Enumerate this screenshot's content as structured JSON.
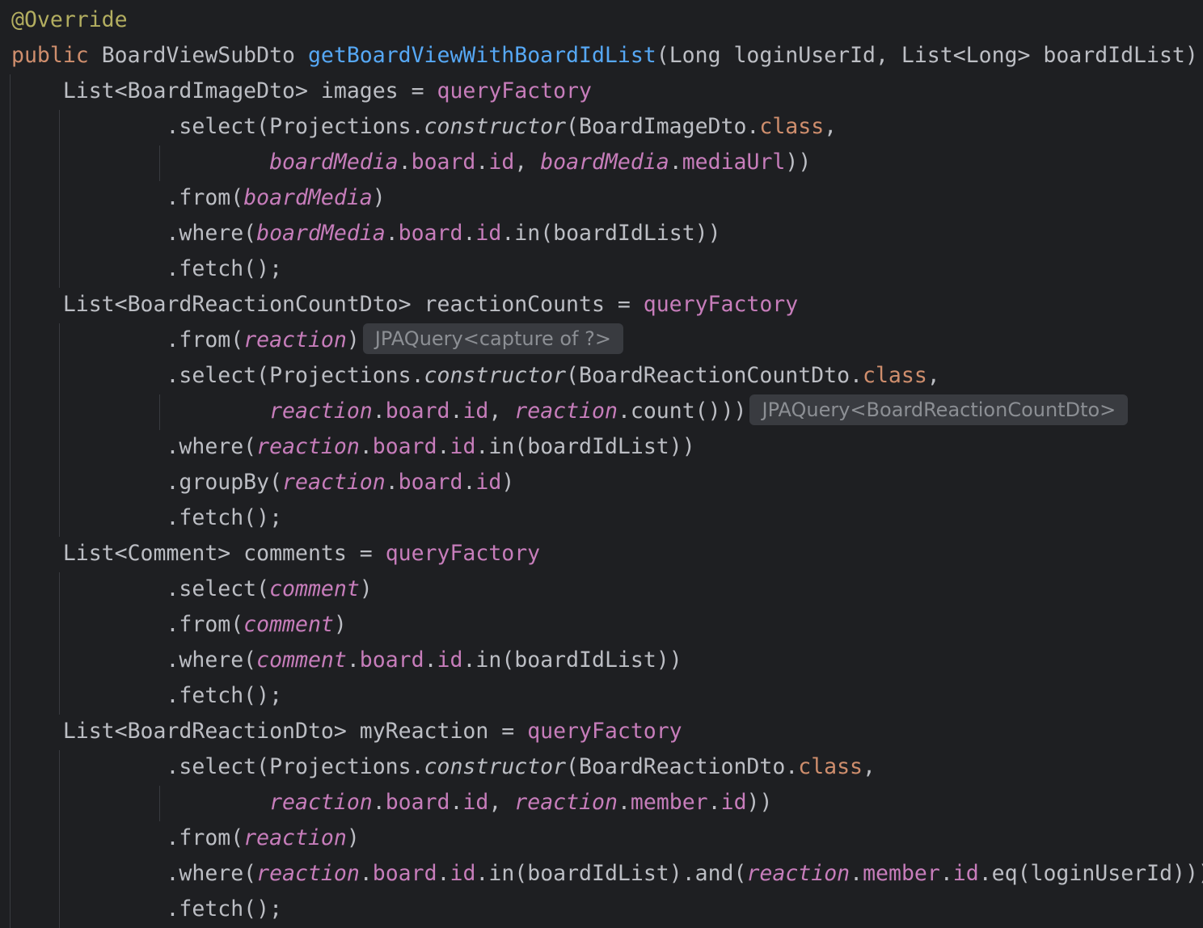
{
  "editor": {
    "theme": "dark",
    "background": "#1e1f22",
    "colors": {
      "plain": "#bcbec4",
      "annotation": "#b3ae60",
      "keyword": "#cf8e6d",
      "method_declaration": "#56a8f5",
      "field": "#c77dbb",
      "inlay_hint": "#8c8f94"
    },
    "lines": [
      [
        {
          "t": "ann",
          "s": "@Override"
        }
      ],
      [
        {
          "t": "kw",
          "s": "public"
        },
        {
          "t": "plain",
          "s": " BoardViewSubDto "
        },
        {
          "t": "fn",
          "s": "getBoardViewWithBoardIdList"
        },
        {
          "t": "plain",
          "s": "(Long loginUserId, List<Long> boardIdList) {"
        }
      ],
      [
        {
          "t": "plain",
          "s": "    List<BoardImageDto> images = "
        },
        {
          "t": "field",
          "s": "queryFactory"
        }
      ],
      [
        {
          "t": "plain",
          "s": "            .select(Projections."
        },
        {
          "t": "italic",
          "s": "constructor"
        },
        {
          "t": "plain",
          "s": "(BoardImageDto."
        },
        {
          "t": "kw",
          "s": "class"
        },
        {
          "t": "plain",
          "s": ","
        }
      ],
      [
        {
          "t": "plain",
          "s": "                    "
        },
        {
          "t": "static",
          "s": "boardMedia"
        },
        {
          "t": "plain",
          "s": "."
        },
        {
          "t": "field",
          "s": "board"
        },
        {
          "t": "plain",
          "s": "."
        },
        {
          "t": "field",
          "s": "id"
        },
        {
          "t": "plain",
          "s": ", "
        },
        {
          "t": "static",
          "s": "boardMedia"
        },
        {
          "t": "plain",
          "s": "."
        },
        {
          "t": "field",
          "s": "mediaUrl"
        },
        {
          "t": "plain",
          "s": "))"
        }
      ],
      [
        {
          "t": "plain",
          "s": "            .from("
        },
        {
          "t": "static",
          "s": "boardMedia"
        },
        {
          "t": "plain",
          "s": ")"
        }
      ],
      [
        {
          "t": "plain",
          "s": "            .where("
        },
        {
          "t": "static",
          "s": "boardMedia"
        },
        {
          "t": "plain",
          "s": "."
        },
        {
          "t": "field",
          "s": "board"
        },
        {
          "t": "plain",
          "s": "."
        },
        {
          "t": "field",
          "s": "id"
        },
        {
          "t": "plain",
          "s": ".in(boardIdList))"
        }
      ],
      [
        {
          "t": "plain",
          "s": "            .fetch();"
        }
      ],
      [
        {
          "t": "plain",
          "s": "    List<BoardReactionCountDto> reactionCounts = "
        },
        {
          "t": "field",
          "s": "queryFactory"
        }
      ],
      [
        {
          "t": "plain",
          "s": "            .from("
        },
        {
          "t": "static",
          "s": "reaction"
        },
        {
          "t": "plain",
          "s": ")"
        },
        {
          "t": "hint",
          "s": "JPAQuery<capture of ?>"
        }
      ],
      [
        {
          "t": "plain",
          "s": "            .select(Projections."
        },
        {
          "t": "italic",
          "s": "constructor"
        },
        {
          "t": "plain",
          "s": "(BoardReactionCountDto."
        },
        {
          "t": "kw",
          "s": "class"
        },
        {
          "t": "plain",
          "s": ","
        }
      ],
      [
        {
          "t": "plain",
          "s": "                    "
        },
        {
          "t": "static",
          "s": "reaction"
        },
        {
          "t": "plain",
          "s": "."
        },
        {
          "t": "field",
          "s": "board"
        },
        {
          "t": "plain",
          "s": "."
        },
        {
          "t": "field",
          "s": "id"
        },
        {
          "t": "plain",
          "s": ", "
        },
        {
          "t": "static",
          "s": "reaction"
        },
        {
          "t": "plain",
          "s": ".count()))"
        },
        {
          "t": "hint",
          "s": "JPAQuery<BoardReactionCountDto>"
        }
      ],
      [
        {
          "t": "plain",
          "s": "            .where("
        },
        {
          "t": "static",
          "s": "reaction"
        },
        {
          "t": "plain",
          "s": "."
        },
        {
          "t": "field",
          "s": "board"
        },
        {
          "t": "plain",
          "s": "."
        },
        {
          "t": "field",
          "s": "id"
        },
        {
          "t": "plain",
          "s": ".in(boardIdList))"
        }
      ],
      [
        {
          "t": "plain",
          "s": "            .groupBy("
        },
        {
          "t": "static",
          "s": "reaction"
        },
        {
          "t": "plain",
          "s": "."
        },
        {
          "t": "field",
          "s": "board"
        },
        {
          "t": "plain",
          "s": "."
        },
        {
          "t": "field",
          "s": "id"
        },
        {
          "t": "plain",
          "s": ")"
        }
      ],
      [
        {
          "t": "plain",
          "s": "            .fetch();"
        }
      ],
      [
        {
          "t": "plain",
          "s": "    List<Comment> comments = "
        },
        {
          "t": "field",
          "s": "queryFactory"
        }
      ],
      [
        {
          "t": "plain",
          "s": "            .select("
        },
        {
          "t": "static",
          "s": "comment"
        },
        {
          "t": "plain",
          "s": ")"
        }
      ],
      [
        {
          "t": "plain",
          "s": "            .from("
        },
        {
          "t": "static",
          "s": "comment"
        },
        {
          "t": "plain",
          "s": ")"
        }
      ],
      [
        {
          "t": "plain",
          "s": "            .where("
        },
        {
          "t": "static",
          "s": "comment"
        },
        {
          "t": "plain",
          "s": "."
        },
        {
          "t": "field",
          "s": "board"
        },
        {
          "t": "plain",
          "s": "."
        },
        {
          "t": "field",
          "s": "id"
        },
        {
          "t": "plain",
          "s": ".in(boardIdList))"
        }
      ],
      [
        {
          "t": "plain",
          "s": "            .fetch();"
        }
      ],
      [
        {
          "t": "plain",
          "s": "    List<BoardReactionDto> myReaction = "
        },
        {
          "t": "field",
          "s": "queryFactory"
        }
      ],
      [
        {
          "t": "plain",
          "s": "            .select(Projections."
        },
        {
          "t": "italic",
          "s": "constructor"
        },
        {
          "t": "plain",
          "s": "(BoardReactionDto."
        },
        {
          "t": "kw",
          "s": "class"
        },
        {
          "t": "plain",
          "s": ","
        }
      ],
      [
        {
          "t": "plain",
          "s": "                    "
        },
        {
          "t": "static",
          "s": "reaction"
        },
        {
          "t": "plain",
          "s": "."
        },
        {
          "t": "field",
          "s": "board"
        },
        {
          "t": "plain",
          "s": "."
        },
        {
          "t": "field",
          "s": "id"
        },
        {
          "t": "plain",
          "s": ", "
        },
        {
          "t": "static",
          "s": "reaction"
        },
        {
          "t": "plain",
          "s": "."
        },
        {
          "t": "field",
          "s": "member"
        },
        {
          "t": "plain",
          "s": "."
        },
        {
          "t": "field",
          "s": "id"
        },
        {
          "t": "plain",
          "s": "))"
        }
      ],
      [
        {
          "t": "plain",
          "s": "            .from("
        },
        {
          "t": "static",
          "s": "reaction"
        },
        {
          "t": "plain",
          "s": ")"
        }
      ],
      [
        {
          "t": "plain",
          "s": "            .where("
        },
        {
          "t": "static",
          "s": "reaction"
        },
        {
          "t": "plain",
          "s": "."
        },
        {
          "t": "field",
          "s": "board"
        },
        {
          "t": "plain",
          "s": "."
        },
        {
          "t": "field",
          "s": "id"
        },
        {
          "t": "plain",
          "s": ".in(boardIdList).and("
        },
        {
          "t": "static",
          "s": "reaction"
        },
        {
          "t": "plain",
          "s": "."
        },
        {
          "t": "field",
          "s": "member"
        },
        {
          "t": "plain",
          "s": "."
        },
        {
          "t": "field",
          "s": "id"
        },
        {
          "t": "plain",
          "s": ".eq(loginUserId)))"
        }
      ],
      [
        {
          "t": "plain",
          "s": "            .fetch();"
        }
      ]
    ]
  }
}
